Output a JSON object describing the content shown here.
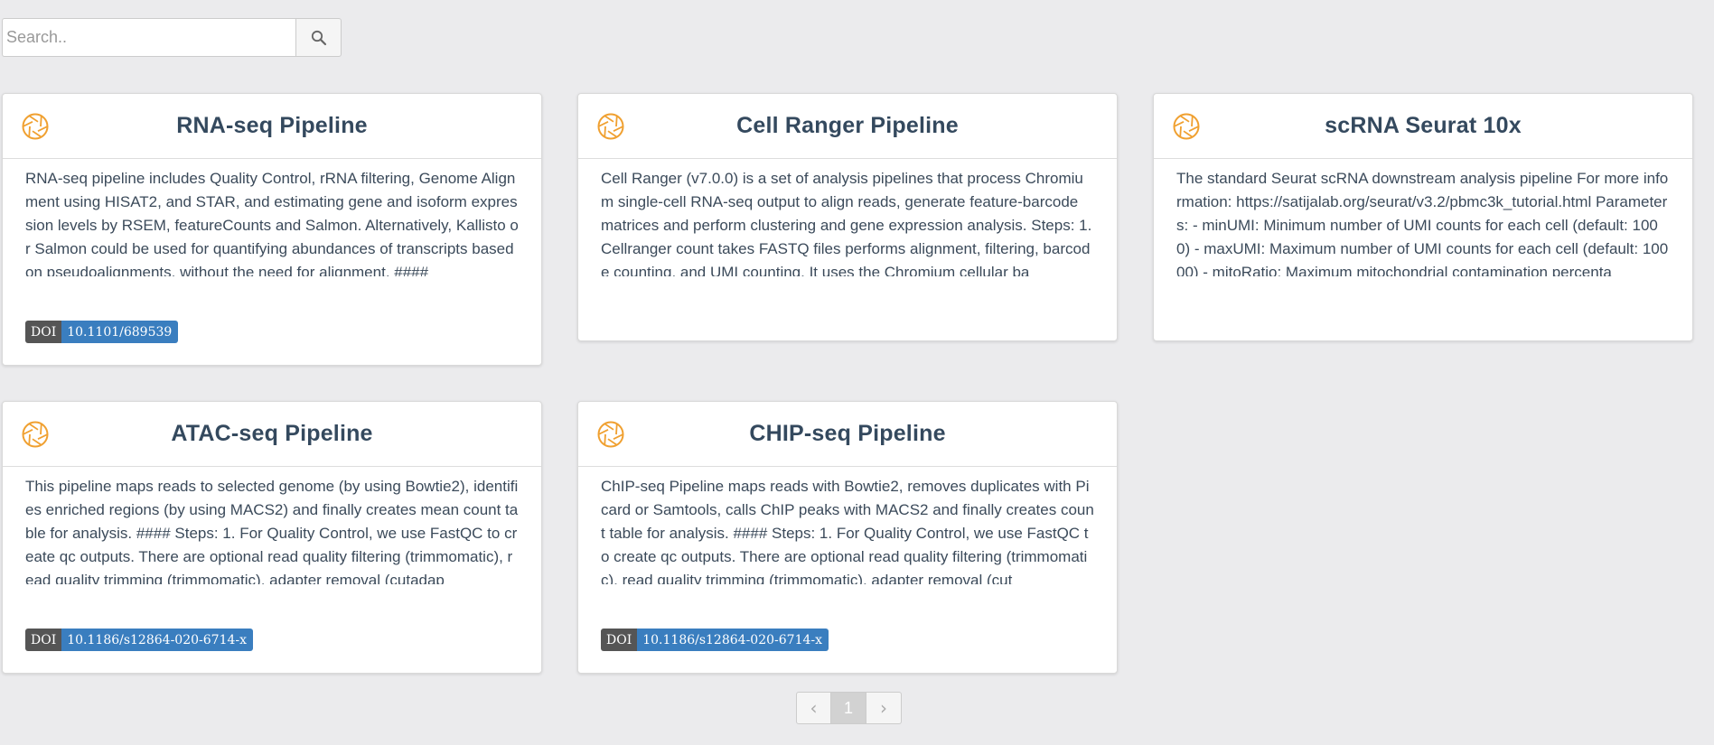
{
  "search": {
    "placeholder": "Search..",
    "icon": "search-icon"
  },
  "colors": {
    "icon_accent": "#f0a030",
    "doi_label_bg": "#555555",
    "doi_value_bg": "#3a7ebf",
    "title": "#34495e"
  },
  "cards": [
    {
      "icon": "aperture-icon",
      "title": "RNA-seq Pipeline",
      "description": "RNA-seq pipeline includes Quality Control, rRNA filtering, Genome Alignment using HISAT2, and STAR, and estimating gene and isoform expression levels by RSEM, featureCounts and Salmon. Alternatively, Kallisto or Salmon could be used for quantifying abundances of transcripts based on pseudoalignments, without the need for alignment. ####",
      "doi_label": "DOI",
      "doi_value": "10.1101/689539"
    },
    {
      "icon": "aperture-icon",
      "title": "Cell Ranger Pipeline",
      "description": "Cell Ranger (v7.0.0) is a set of analysis pipelines that process Chromium single-cell RNA-seq output to align reads, generate feature-barcode matrices and perform clustering and gene expression analysis. Steps: 1. Cellranger count takes FASTQ files performs alignment, filtering, barcode counting, and UMI counting. It uses the Chromium cellular ba"
    },
    {
      "icon": "aperture-icon",
      "title": "scRNA Seurat 10x",
      "description": "The standard Seurat scRNA downstream analysis pipeline For more information: https://satijalab.org/seurat/v3.2/pbmc3k_tutorial.html Parameters: - minUMI: Minimum number of UMI counts for each cell (default: 1000) - maxUMI: Maximum number of UMI counts for each cell (default: 10000) - mitoRatio: Maximum mitochondrial contamination percenta"
    },
    {
      "icon": "aperture-icon",
      "title": "ATAC-seq Pipeline",
      "description": "This pipeline maps reads to selected genome (by using Bowtie2), identifies enriched regions (by using MACS2) and finally creates mean count table for analysis. #### Steps: 1. For Quality Control, we use FastQC to create qc outputs. There are optional read quality filtering (trimmomatic), read quality trimming (trimmomatic), adapter removal (cutadap",
      "doi_label": "DOI",
      "doi_value": "10.1186/s12864-020-6714-x"
    },
    {
      "icon": "aperture-icon",
      "title": "CHIP-seq Pipeline",
      "description": "ChIP-seq Pipeline maps reads with Bowtie2, removes duplicates with Picard or Samtools, calls ChIP peaks with MACS2 and finally creates count table for analysis. #### Steps: 1. For Quality Control, we use FastQC to create qc outputs. There are optional read quality filtering (trimmomatic), read quality trimming (trimmomatic), adapter removal (cut",
      "doi_label": "DOI",
      "doi_value": "10.1186/s12864-020-6714-x"
    }
  ],
  "pagination": {
    "prev": "‹",
    "current": "1",
    "next": "›"
  }
}
